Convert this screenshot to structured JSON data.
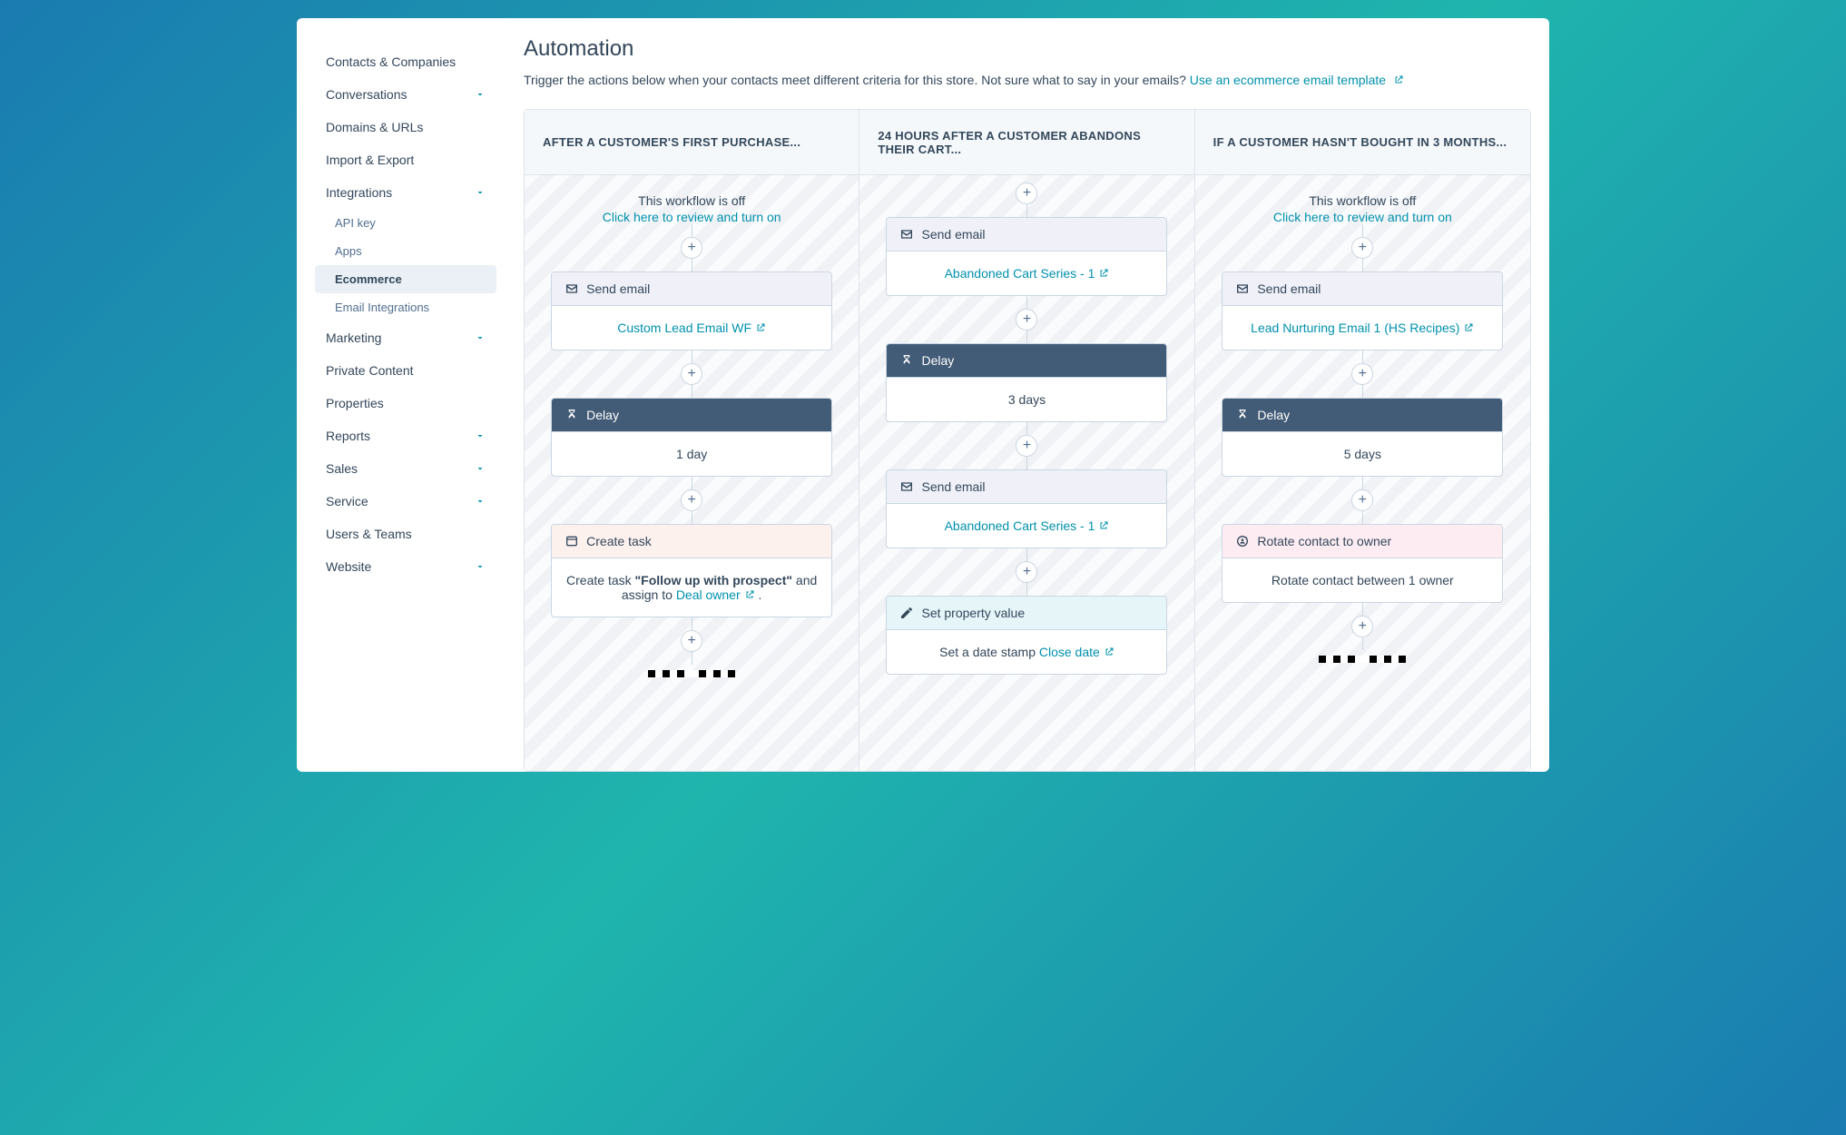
{
  "sidebar": {
    "items": [
      {
        "label": "Contacts & Companies",
        "expandable": false
      },
      {
        "label": "Conversations",
        "expandable": true
      },
      {
        "label": "Domains & URLs",
        "expandable": false
      },
      {
        "label": "Import & Export",
        "expandable": false
      },
      {
        "label": "Integrations",
        "expandable": true,
        "children": [
          {
            "label": "API key"
          },
          {
            "label": "Apps"
          },
          {
            "label": "Ecommerce",
            "active": true
          },
          {
            "label": "Email Integrations"
          }
        ]
      },
      {
        "label": "Marketing",
        "expandable": true
      },
      {
        "label": "Private Content",
        "expandable": false
      },
      {
        "label": "Properties",
        "expandable": false
      },
      {
        "label": "Reports",
        "expandable": true
      },
      {
        "label": "Sales",
        "expandable": true
      },
      {
        "label": "Service",
        "expandable": true
      },
      {
        "label": "Users & Teams",
        "expandable": false
      },
      {
        "label": "Website",
        "expandable": true
      }
    ]
  },
  "page": {
    "title": "Automation",
    "subtitle_prefix": "Trigger the actions below when your contacts meet different criteria for this store. Not sure what to say in your emails? ",
    "subtitle_link": "Use an ecommerce email template"
  },
  "workflows": [
    {
      "title": "AFTER A CUSTOMER'S FIRST PURCHASE...",
      "off_text": "This workflow is off",
      "off_link": "Click here to review and turn on",
      "start_half_plus": false,
      "steps": [
        {
          "type": "send-email",
          "header": "Send email",
          "body_link": "Custom Lead Email WF",
          "body_external": true
        },
        {
          "type": "delay",
          "header": "Delay",
          "body_text": "1 day"
        },
        {
          "type": "create-task",
          "header": "Create task",
          "body_parts": {
            "p1": "Create task ",
            "p2": "\"Follow up with prospect\"",
            "p3": " and assign to ",
            "link": "Deal owner",
            "p4": " ."
          }
        }
      ],
      "trailing_plus": true,
      "checkers": true
    },
    {
      "title": "24 HOURS AFTER A CUSTOMER ABANDONS THEIR CART...",
      "start_half_plus": true,
      "steps": [
        {
          "type": "send-email",
          "header": "Send email",
          "body_link": "Abandoned Cart Series - 1",
          "body_external": true
        },
        {
          "type": "delay",
          "header": "Delay",
          "body_text": "3 days"
        },
        {
          "type": "send-email",
          "header": "Send email",
          "body_link": "Abandoned Cart Series - 1",
          "body_external": true
        },
        {
          "type": "set-property",
          "header": "Set property value",
          "body_parts": {
            "p1": "Set a date stamp ",
            "link": "Close date",
            "external": true
          }
        }
      ]
    },
    {
      "title": "IF A CUSTOMER HASN'T BOUGHT IN 3 MONTHS...",
      "off_text": "This workflow is off",
      "off_link": "Click here to review and turn on",
      "start_half_plus": false,
      "steps": [
        {
          "type": "send-email",
          "header": "Send email",
          "body_link": "Lead Nurturing Email 1 (HS Recipes)",
          "body_external": true
        },
        {
          "type": "delay",
          "header": "Delay",
          "body_text": "5 days"
        },
        {
          "type": "rotate",
          "header": "Rotate contact to owner",
          "body_text": "Rotate contact between 1 owner"
        }
      ],
      "trailing_plus": true,
      "checkers": true
    }
  ]
}
